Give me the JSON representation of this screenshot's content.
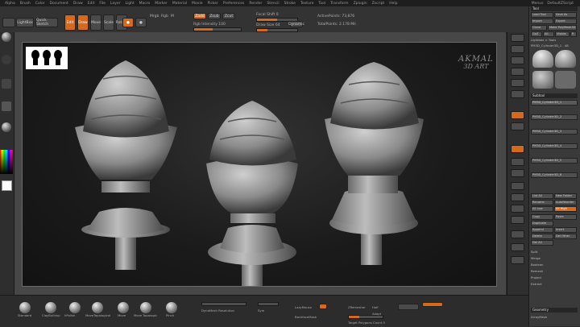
{
  "menu": {
    "items": [
      "Alpha",
      "Brush",
      "Color",
      "Document",
      "Draw",
      "Edit",
      "File",
      "Layer",
      "Light",
      "Macro",
      "Marker",
      "Material",
      "Movie",
      "Picker",
      "Preferences",
      "Render",
      "Stencil",
      "Stroke",
      "Texture",
      "Tool",
      "Transform",
      "Zplugin",
      "Zscript",
      "Help"
    ],
    "right": [
      "Menus",
      "DefaultZScript"
    ]
  },
  "toolbar": {
    "lightbox": "LightBox",
    "quicksketch": "Quick Sketch",
    "edit": "Edit",
    "draw": "Draw",
    "move": "Move",
    "scale": "Scale",
    "rotate": "Rotate",
    "mrgb": "Mrgb",
    "rgb": "Rgb",
    "m": "M",
    "zadd": "Zadd",
    "zsub": "Zsub",
    "zcut": "Zcut",
    "focal_shift": "Focal Shift 0",
    "draw_size": "Draw Size 64",
    "z_intensity": "Z Intensity 25",
    "rgb_intensity": "Rgb Intensity 100",
    "dynamic": "Dynamic",
    "active_points": "ActivePoints: 73,876",
    "total_points": "TotalPoints: 2.178 Mil"
  },
  "watermark": {
    "title": "AKMAL",
    "subtitle": "3D ART"
  },
  "right_panel": {
    "head1": "Tool",
    "items_top": [
      "Load Tool",
      "Save As",
      "Import",
      "Export",
      "Clone",
      "Make PolyMesh3D",
      "GoZ",
      "All",
      "Visible",
      "R",
      "Lightbox > Tools",
      "PM3D_Cylinder3D_1 . 48"
    ],
    "subtool_head": "Subtool",
    "subtools": [
      "PM3D_Cylinder3D_1",
      "PM3D_Cylinder3D_2",
      "PM3D_Cylinder3D_3",
      "PM3D_Cylinder3D_4",
      "PM3D_Cylinder3D_5",
      "PM3D_Cylinder3D_6"
    ],
    "list_all": "List All",
    "new_folder": "New Folder",
    "rename": "Rename",
    "autoreorder": "AutoReorder",
    "all_low": "All Low",
    "all_high": "All High",
    "copy": "Copy",
    "paste": "Paste",
    "duplicate": "Duplicate",
    "append": "Append",
    "insert": "Insert",
    "delete": "Delete",
    "del_other": "Del Other",
    "del_all": "Del All",
    "split": "Split",
    "merge": "Merge",
    "boolean": "Boolean",
    "remesh": "Remesh",
    "project": "Project",
    "extract": "Extract",
    "geometry": "Geometry",
    "arraymesh": "ArrayMesh"
  },
  "bottom": {
    "brushes": [
      "Standard",
      "ClayBuildup",
      "hPolish",
      "MoveTopological",
      "Move",
      "Move Topologic",
      "Pinch"
    ],
    "dyna": "DynaMesh Resolution",
    "symm": "Sym",
    "lazy": "LazyMouse",
    "backface": "BackfaceMask",
    "zremesh": "ZRemesher",
    "target": "Target Polygons Count 5",
    "half": "Half",
    "adapt": "Adapt"
  }
}
